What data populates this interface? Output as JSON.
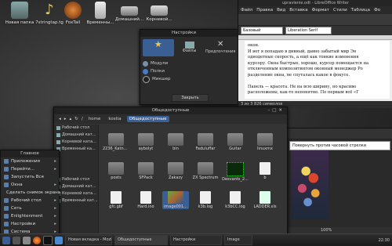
{
  "desktop_icons": [
    {
      "label": "Новая папка",
      "icon": "folder-icon"
    },
    {
      "label": "7stringtap.tg",
      "icon": "music-note-icon"
    },
    {
      "label": "FoxTail",
      "icon": "fox-avatar-icon"
    },
    {
      "label": "Временны...",
      "icon": "trash-icon"
    },
    {
      "label": "Домашний...",
      "icon": "drive-icon"
    },
    {
      "label": "Корневой...",
      "icon": "laptop-icon"
    }
  ],
  "settings_window": {
    "title": "Настройки",
    "tabs": [
      {
        "label": "",
        "icon": "star-icon"
      },
      {
        "label": "Файлы",
        "icon": "folder-icon"
      },
      {
        "label": "Предпочтения",
        "icon": "tools-icon"
      }
    ],
    "items": [
      "Модули",
      "Полки",
      "Микшер"
    ],
    "close_label": "Закрыть"
  },
  "writer": {
    "title": "upravlenie.odt - LibreOffice Writer",
    "menu": [
      "Файл",
      "Правка",
      "Вид",
      "Вставка",
      "Формат",
      "Стили",
      "Таблица",
      "Фо"
    ],
    "style": "Базовый",
    "font": "Liberation Serif",
    "doc_lines": [
      "окон.",
      "И вот я попадаю в дивный, давно забытый мир Эн",
      "однодетные скорость, а ещё как тонкие изменения",
      "курсору. Окна быстрые, хорошо, курсор помещается на",
      "отключенным композитингом оконный менеджер Ро",
      "разделение окна, не спуталась какое в фокусе.",
      "",
      "Панель — красота. Не на всю ширину, но красиво",
      "расположены, как-то непонятно. По первым всё «Г"
    ],
    "status": "3 из 3  826 символов"
  },
  "viewer": {
    "rotate_button": "Повернуть против часовой стрелки",
    "zoom": "100%",
    "image_alt": "Букет цветов"
  },
  "file_manager": {
    "title": "Общедоступные",
    "path": [
      "home",
      "kostia",
      "Общедоступные"
    ],
    "sidebar": [
      "Рабочий стол",
      "Домашний кат...",
      "Корневой ката...",
      "Временный ка...",
      "Рабочий стол",
      "Домашний кат...",
      "Корневой ката...",
      "Временный кат..."
    ],
    "files": [
      {
        "name": "2236_Katno...",
        "type": "folder"
      },
      {
        "name": "aybolyt",
        "type": "folder"
      },
      {
        "name": "bin",
        "type": "folder"
      },
      {
        "name": "Faduluffar",
        "type": "folder"
      },
      {
        "name": "Guitar",
        "type": "folder"
      },
      {
        "name": "linuxmx",
        "type": "folder"
      },
      {
        "name": "posts",
        "type": "folder"
      },
      {
        "name": "SFPack",
        "type": "folder"
      },
      {
        "name": "Zakazy",
        "type": "folder"
      },
      {
        "name": "ZX Spectrum",
        "type": "folder"
      },
      {
        "name": "Desvants_2...",
        "type": "image"
      },
      {
        "name": "b",
        "type": "document"
      },
      {
        "name": "gfc.gbf",
        "type": "document"
      },
      {
        "name": "Hard.ino",
        "type": "document"
      },
      {
        "name": "image001...",
        "type": "image"
      },
      {
        "name": "k3b.log",
        "type": "document"
      },
      {
        "name": "k3bCC.log",
        "type": "document"
      },
      {
        "name": "LADDER.xls",
        "type": "document"
      }
    ]
  },
  "app_menu": {
    "header": "Главное",
    "items": [
      {
        "label": "Приложения",
        "arrow": true
      },
      {
        "label": "Перейти...",
        "arrow": true
      },
      {
        "label": "Запустить Вся",
        "arrow": false
      },
      {
        "label": "Окна",
        "arrow": true
      },
      {
        "label": "Сделать снимок экрана",
        "arrow": false
      },
      {
        "label": "Рабочий стол",
        "arrow": true
      },
      {
        "label": "Сеть",
        "arrow": true
      },
      {
        "label": "Enlightenment",
        "arrow": true
      },
      {
        "label": "Настройки",
        "arrow": true
      },
      {
        "label": "Система",
        "arrow": true
      }
    ]
  },
  "taskbar": {
    "tasks": [
      "Новая вкладка - Mozilla Firefox",
      "Общедоступные",
      "Настройки",
      "Image"
    ],
    "clock": "22:30"
  },
  "colors": {
    "accent": "#3a5f94",
    "panel": "#2b2b2b"
  }
}
